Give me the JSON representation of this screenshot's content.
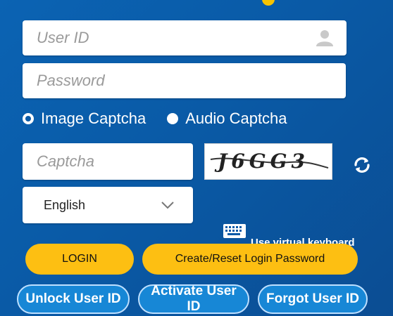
{
  "login_form": {
    "user_id_placeholder": "User ID",
    "password_placeholder": "Password",
    "captcha_options": [
      {
        "label": "Image Captcha",
        "selected": true
      },
      {
        "label": "Audio Captcha",
        "selected": false
      }
    ],
    "captcha_placeholder": "Captcha",
    "captcha_image_text": "J6GG3",
    "language_selected": "English",
    "virtual_keyboard_label": "Use virtual keyboard",
    "login_label": "LOGIN",
    "reset_label": "Create/Reset Login Password",
    "unlock_label": "Unlock User ID",
    "activate_label": "Activate User ID",
    "forgot_label": "Forgot User ID"
  },
  "colors": {
    "background": "#0b5aa7",
    "primary_button": "#fdbf12",
    "secondary_button": "#1787d6"
  }
}
